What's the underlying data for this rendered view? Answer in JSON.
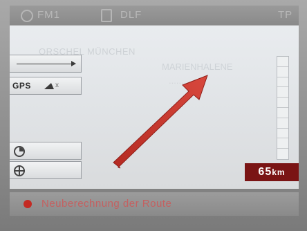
{
  "status_bar": {
    "band": "FM1",
    "station": "DLF",
    "tp": "TP"
  },
  "map": {
    "street_name": "ORSCHEL MÜNCHEN",
    "street_name_2": "MARIENHALENE",
    "street_name_3": "..........",
    "arrow_color": "#c8352c"
  },
  "left_panel": {
    "gps_label": "GPS",
    "gps_marker": "x"
  },
  "scale": {
    "distance_value": "65",
    "distance_unit": "km",
    "segments": 10
  },
  "bottom_bar": {
    "message": "Neuberechnung der Route"
  },
  "colors": {
    "accent_red": "#7a1414",
    "dot_red": "#c42a23"
  }
}
